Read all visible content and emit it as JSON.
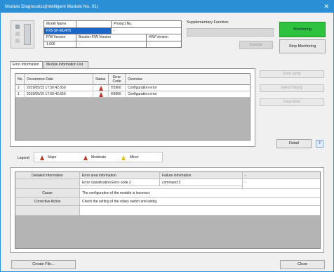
{
  "window": {
    "title": "Module Diagnostics(Intelligent Module No. 01)",
    "close_glyph": "✕"
  },
  "module": {
    "headers": {
      "model_name": "Model Name",
      "product_no": "Product No.",
      "fw_version": "F/W Version",
      "booster_fw_version": "Booster F/W Version",
      "hw_version": "H/W Version"
    },
    "model_name": "FX5-SF-MU4T5",
    "product_no": "-",
    "fw_version": "1.000",
    "booster_fw_version": "-",
    "hw_version": "-"
  },
  "supplementary": {
    "label": "Supplementary Function",
    "execute_label": "Execute"
  },
  "monitor": {
    "monitoring_label": "Monitoring",
    "stop_label": "Stop Monitoring",
    "monitoring_color": "#2ec23e"
  },
  "tabs": [
    {
      "label": "Error Information"
    },
    {
      "label": "Module Information List"
    }
  ],
  "errors": {
    "headers": {
      "no": "No.",
      "occurrence": "Occurrence Date",
      "status": "Status",
      "code_line1": "Error",
      "code_line2": "Code",
      "overview": "Overview"
    },
    "rows": [
      {
        "no": "2",
        "date": "2019/05/15 17:50:42.650",
        "status_icon": "major-error-icon",
        "code": "H3966",
        "overview": "Configuration error"
      },
      {
        "no": "1",
        "date": "2019/05/15 17:50:42.650",
        "status_icon": "major-error-icon",
        "code": "H3966",
        "overview": "Configuration error"
      }
    ]
  },
  "side_buttons": {
    "error_jump": "Error Jump",
    "event_history": "Event History",
    "clear_error": "Clear Error"
  },
  "detail_button": {
    "label": "Detail",
    "arrow": "⇕"
  },
  "legend": {
    "label": "Legend",
    "major": "Major",
    "moderate": "Moderate",
    "minor": "Minor",
    "major_color": "#c0392b",
    "moderate_color": "#c0392b",
    "minor_color": "#e8c21b"
  },
  "details": {
    "headers": {
      "detailed_information": "Detailed Information",
      "error_area": "Error area information",
      "failure_info": "Failure information",
      "dash": "-"
    },
    "error_classification": "Error classification:Error code 2",
    "command": "command:3",
    "dash_value": "-",
    "cause_label": "Cause",
    "cause_text": "The configuration of the module is incorrect.",
    "corrective_label": "Corrective Action",
    "corrective_text": "Check the setting of the rotary switch and wiring."
  },
  "footer": {
    "create_file": "Create File...",
    "close": "Close"
  }
}
